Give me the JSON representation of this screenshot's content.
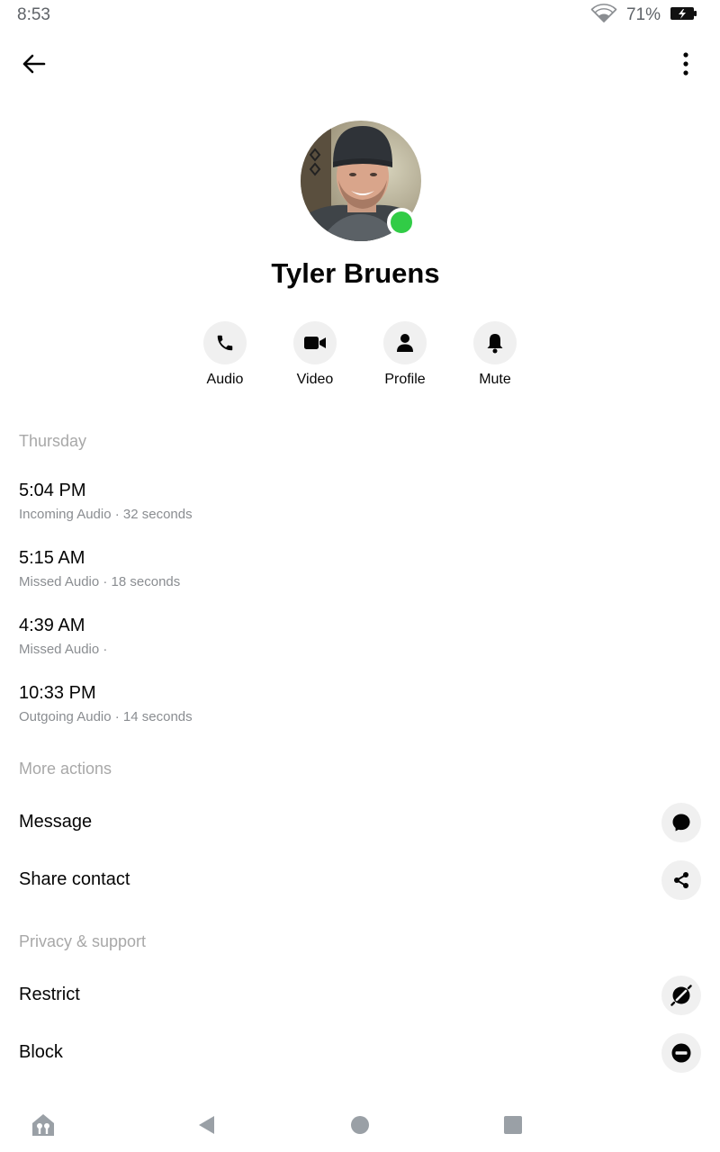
{
  "status_bar": {
    "time": "8:53",
    "battery_percent": "71%",
    "icons": [
      "wifi-icon",
      "battery-charging-icon"
    ]
  },
  "top_bar": {
    "back_icon": "arrow-left-icon",
    "menu_icon": "more-vertical-icon"
  },
  "profile": {
    "name": "Tyler Bruens",
    "online": true,
    "online_color": "#31cc46"
  },
  "quick_actions": [
    {
      "label": "Audio",
      "icon": "phone-icon"
    },
    {
      "label": "Video",
      "icon": "video-camera-icon"
    },
    {
      "label": "Profile",
      "icon": "person-icon"
    },
    {
      "label": "Mute",
      "icon": "bell-icon"
    }
  ],
  "call_history": {
    "title": "Thursday",
    "calls": [
      {
        "time": "5:04 PM",
        "detail": "Incoming Audio · 32 seconds"
      },
      {
        "time": "5:15 AM",
        "detail": "Missed Audio · 18 seconds"
      },
      {
        "time": "4:39 AM",
        "detail": "Missed Audio ·"
      },
      {
        "time": "10:33 PM",
        "detail": "Outgoing Audio · 14 seconds"
      }
    ]
  },
  "more_actions": {
    "title": "More actions",
    "items": [
      {
        "label": "Message",
        "icon": "chat-bubble-icon"
      },
      {
        "label": "Share contact",
        "icon": "share-icon"
      }
    ]
  },
  "privacy_support": {
    "title": "Privacy & support",
    "items": [
      {
        "label": "Restrict",
        "icon": "restrict-icon"
      },
      {
        "label": "Block",
        "icon": "block-icon"
      }
    ]
  },
  "nav_bar": {
    "items": [
      "home-app-icon",
      "back-triangle-icon",
      "home-circle-icon",
      "recents-square-icon"
    ]
  }
}
